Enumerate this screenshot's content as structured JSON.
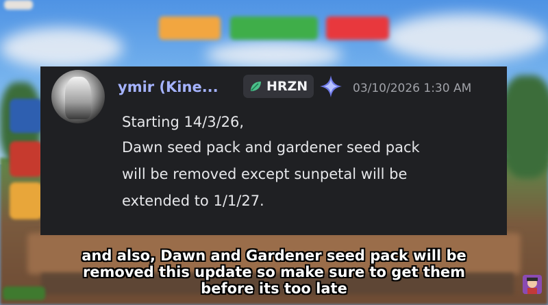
{
  "message": {
    "username": "ymir (Kine...",
    "role_tag": "HRZN",
    "timestamp": "03/10/2026 1:30 AM",
    "lines": [
      "Starting 14/3/26,",
      "Dawn seed pack and gardener seed pack",
      "will be removed except sunpetal will be",
      "extended to 1/1/27."
    ]
  },
  "subtitles": [
    "and also, Dawn and Gardener seed pack will be",
    "removed this update so make sure to get them",
    "before its too late"
  ],
  "icons": {
    "role_icon": "leaf-icon",
    "badge_icon": "sparkle-icon"
  },
  "colors": {
    "username": "#a5b3ff",
    "card_background": "#1f2023",
    "timestamp": "#a0a2a8"
  }
}
